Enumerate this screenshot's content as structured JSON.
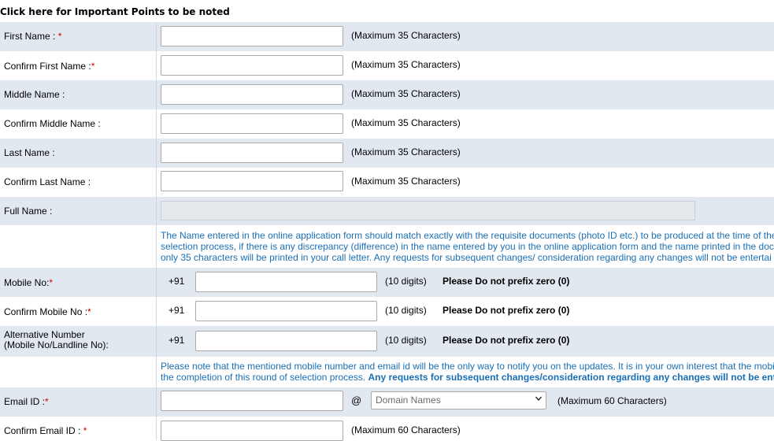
{
  "top_link": "Click here for Important Points to be noted",
  "required_mark": "*",
  "fields": {
    "first_name": {
      "label": "First Name :",
      "hint": "(Maximum 35 Characters)"
    },
    "confirm_first_name": {
      "label": "Confirm First Name :",
      "hint": "(Maximum 35 Characters)"
    },
    "middle_name": {
      "label": "Middle Name :",
      "hint": "(Maximum 35 Characters)"
    },
    "confirm_middle_name": {
      "label": "Confirm Middle Name :",
      "hint": "(Maximum 35 Characters)"
    },
    "last_name": {
      "label": "Last Name :",
      "hint": "(Maximum 35 Characters)"
    },
    "confirm_last_name": {
      "label": "Confirm Last Name :",
      "hint": "(Maximum 35 Characters)"
    },
    "full_name": {
      "label": "Full Name :"
    }
  },
  "name_note": {
    "line1": "The Name entered in the online application form should match exactly with the requisite documents (photo ID etc.) to be produced at the time of the",
    "line2": "selection process, if there is any discrepancy (difference) in the name entered by you in the online application form and the name printed in the doc",
    "line3": "only 35 characters will be printed in your call letter. Any requests for subsequent changes/ consideration regarding any changes will not be entertai"
  },
  "mobile": {
    "mobile_no": {
      "label": "Mobile No:",
      "code": "+91",
      "digits": "(10 digits)",
      "warning": "Please Do not prefix zero (0)"
    },
    "confirm_mobile_no": {
      "label": "Confirm Mobile No :",
      "code": "+91",
      "digits": "(10 digits)",
      "warning": "Please Do not prefix zero (0)"
    },
    "alternative": {
      "label_line1": "Alternative Number",
      "label_line2": "(Mobile No/Landline No):",
      "code": "+91",
      "digits": "(10 digits)",
      "warning": "Please Do not prefix zero (0)"
    }
  },
  "contact_note": {
    "line1": "Please note that the mentioned mobile number and email id will be the only way to notify you on the updates. It is in your own interest that the mobi",
    "line2_plain": "the completion of this round of selection process. ",
    "line2_bold": "Any requests for subsequent changes/consideration regarding any changes will not be ent"
  },
  "email": {
    "label": "Email ID :",
    "at": "@",
    "domain_placeholder": "Domain Names",
    "hint": "(Maximum 60 Characters)"
  },
  "confirm_email": {
    "label": "Confirm Email ID :",
    "hint": "(Maximum 60 Characters)"
  },
  "colors": {
    "row_shade": "#e1e8f0",
    "note_blue": "#1a6fb5",
    "required_red": "#cc0000"
  }
}
